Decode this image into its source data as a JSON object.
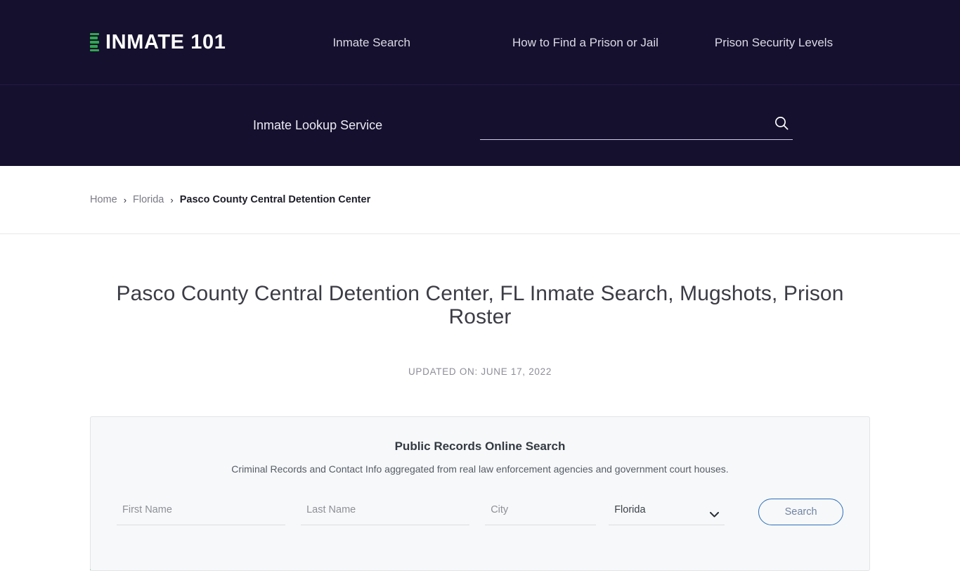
{
  "header": {
    "logo_text": "INMATE 101",
    "logo_icon": "prison-bars-icon",
    "nav": [
      {
        "label": "Inmate Search"
      },
      {
        "label": "How to Find a Prison or Jail"
      },
      {
        "label": "Prison Security Levels"
      }
    ]
  },
  "hero": {
    "label": "Inmate Lookup Service",
    "search_value": "",
    "search_placeholder": "",
    "search_icon": "search-icon"
  },
  "breadcrumb": {
    "items": [
      {
        "label": "Home"
      },
      {
        "label": "Florida"
      }
    ],
    "separator": "›",
    "current": "Pasco County Central Detention Center"
  },
  "main": {
    "title": "Pasco County Central Detention Center, FL Inmate Search, Mugshots, Prison Roster",
    "updated": "UPDATED ON: JUNE 17, 2022"
  },
  "records_card": {
    "title": "Public Records Online Search",
    "subtitle": "Criminal Records and Contact Info aggregated from real law enforcement agencies and government court houses.",
    "first_name_placeholder": "First Name",
    "first_name_value": "",
    "last_name_placeholder": "Last Name",
    "last_name_value": "",
    "city_placeholder": "City",
    "city_value": "",
    "state_selected": "Florida",
    "state_options": [
      "Florida"
    ],
    "search_label": "Search",
    "chevron_icon": "chevron-down-icon"
  },
  "colors": {
    "header_bg": "#15102e",
    "accent_green": "#2fa84f",
    "button_blue": "#2c6fbb",
    "card_bg": "#f7f8f9"
  }
}
